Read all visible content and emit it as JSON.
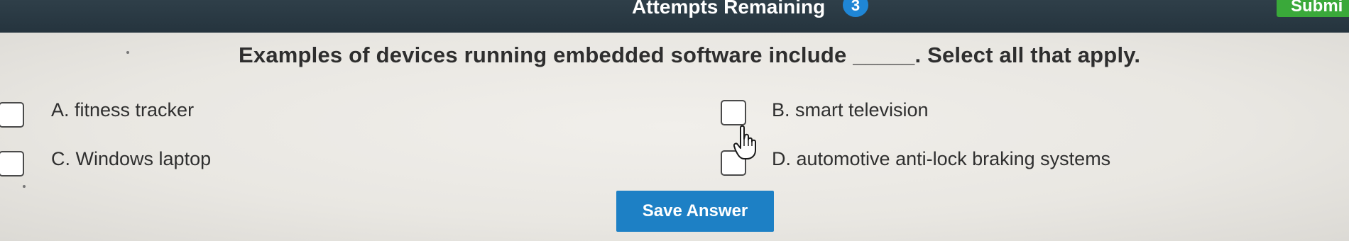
{
  "header": {
    "attempts_label": "Attempts Remaining",
    "attempts_count": "3",
    "submit_label": "Submi"
  },
  "question": {
    "text": "Examples of devices running embedded software include _____. Select all that apply."
  },
  "options": [
    {
      "label": "A. fitness tracker",
      "checked": false
    },
    {
      "label": "B. smart television",
      "checked": false
    },
    {
      "label": "C. Windows laptop",
      "checked": false
    },
    {
      "label": "D. automotive anti-lock braking systems",
      "checked": false
    }
  ],
  "save_button": {
    "label": "Save Answer"
  },
  "colors": {
    "header_bg": "#2f3f49",
    "badge": "#1f86d6",
    "submit": "#3aa93a",
    "save": "#1d80c5",
    "page_bg": "#e8e6e1"
  },
  "icons": {
    "cursor": "hand-pointer-icon"
  }
}
